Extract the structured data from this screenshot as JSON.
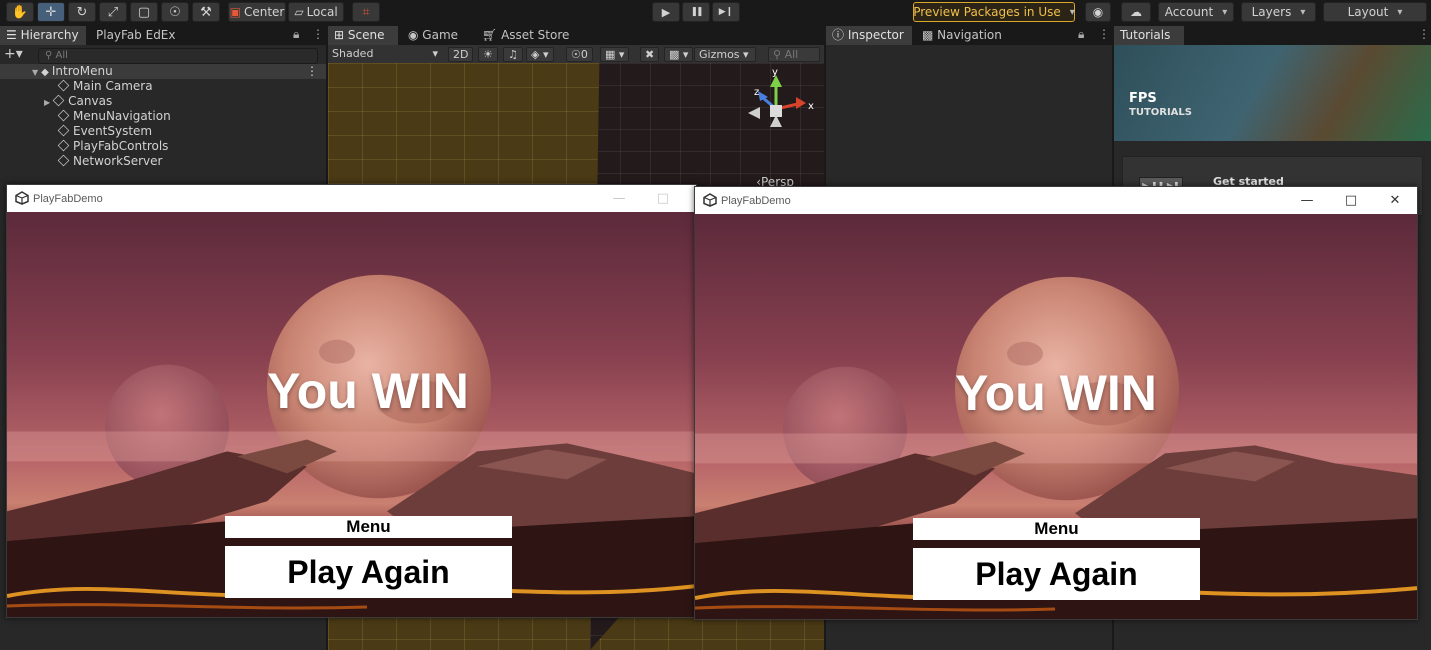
{
  "toolbar": {
    "tools": [
      {
        "icon": "hand-icon",
        "glyph": "✋"
      },
      {
        "icon": "move-icon",
        "glyph": "✛"
      },
      {
        "icon": "rotate-icon",
        "glyph": "↻"
      },
      {
        "icon": "scale-icon",
        "glyph": "⤢"
      },
      {
        "icon": "rect-icon",
        "glyph": "▢"
      },
      {
        "icon": "transform-icon",
        "glyph": "☉"
      },
      {
        "icon": "custom-tool-icon",
        "glyph": "⚒"
      }
    ],
    "pivot_mode": "Center",
    "pivot_rotation": "Local",
    "grid_snap_glyph": "⌗",
    "play_glyph": "▶",
    "pause_glyph": "❚❚",
    "step_glyph": "▶❙",
    "preview_packages": "Preview Packages in Use",
    "account": "Account",
    "layers": "Layers",
    "layout": "Layout"
  },
  "hierarchy": {
    "tabs": [
      "Hierarchy",
      "PlayFab EdEx"
    ],
    "search_placeholder": "All",
    "scene_name": "IntroMenu",
    "items": [
      "Main Camera",
      "Canvas",
      "MenuNavigation",
      "EventSystem",
      "PlayFabControls",
      "NetworkServer"
    ]
  },
  "scene_panel": {
    "tabs": [
      "Scene",
      "Game",
      "Asset Store"
    ],
    "shading": "Shaded",
    "mode_2d": "2D",
    "hidden_count": "0",
    "gizmos": "Gizmos",
    "search_placeholder": "All",
    "persp": "‹Persp",
    "axis_labels": {
      "x": "x",
      "y": "y",
      "z": "z"
    }
  },
  "inspector_panel": {
    "tabs": [
      "Inspector",
      "Navigation"
    ]
  },
  "tutorials_panel": {
    "tab": "Tutorials",
    "banner_title": "FPS",
    "banner_subtitle": "TUTORIALS",
    "card_title": "Get started"
  },
  "game_windows": [
    {
      "title": "PlayFabDemo",
      "win_text": "You WIN",
      "menu_label": "Menu",
      "play_again_label": "Play Again",
      "controls": {
        "minimize": "—",
        "maximize": "□",
        "close": "✕"
      }
    },
    {
      "title": "PlayFabDemo",
      "win_text": "You WIN",
      "menu_label": "Menu",
      "play_again_label": "Play Again",
      "controls": {
        "minimize": "—",
        "maximize": "□",
        "close": "✕"
      }
    }
  ],
  "colors": {
    "preview_accent": "#d8a82a",
    "selected_tool": "#46607c",
    "panel_bg": "#282828"
  }
}
